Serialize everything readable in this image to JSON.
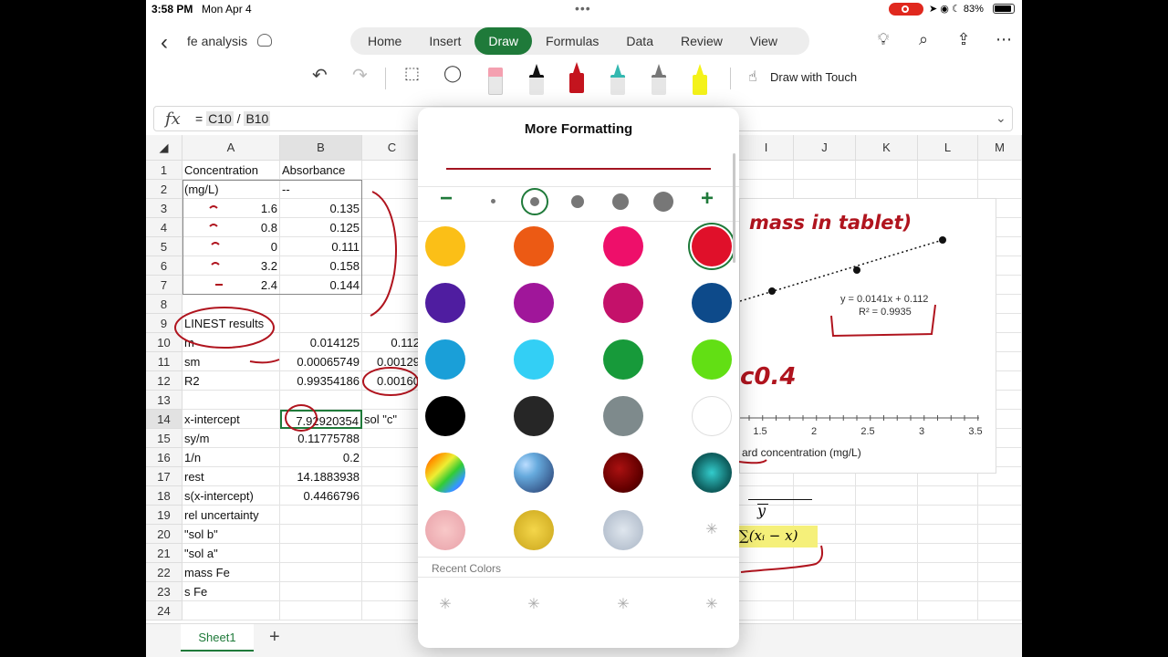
{
  "status": {
    "time": "3:58 PM",
    "date": "Mon Apr 4",
    "battery": "83%"
  },
  "app": {
    "title": "fe analysis",
    "tabs": [
      "Home",
      "Insert",
      "Draw",
      "Formulas",
      "Data",
      "Review",
      "View"
    ],
    "active_tab": "Draw",
    "draw_with_touch": "Draw with Touch"
  },
  "formula": {
    "fx": "fx",
    "prefix": "= ",
    "ref1": "C10",
    "op": " / ",
    "ref2": "B10"
  },
  "columns": [
    "A",
    "B",
    "C",
    "I",
    "J",
    "K",
    "L",
    "M"
  ],
  "rows": [
    "1",
    "2",
    "3",
    "4",
    "5",
    "6",
    "7",
    "8",
    "9",
    "10",
    "11",
    "12",
    "13",
    "14",
    "15",
    "16",
    "17",
    "18",
    "19",
    "20",
    "21",
    "22",
    "23",
    "24"
  ],
  "cells": {
    "A1": "Concentration",
    "B1": "Absorbance",
    "A2": "(mg/L)",
    "B2": "--",
    "A3": "1.6",
    "B3": "0.135",
    "A4": "0.8",
    "B4": "0.125",
    "A5": "0",
    "B5": "0.111",
    "A6": "3.2",
    "B6": "0.158",
    "A7": "2.4",
    "B7": "0.144",
    "A9": "LINEST results",
    "A10": "m",
    "B10": "0.014125",
    "C10": "0.112",
    "A11": "sm",
    "B11": "0.00065749",
    "C11": "0.00129",
    "A12": "R2",
    "B12": "0.99354186",
    "C12": "0.00160",
    "A14": "x-intercept",
    "B14": "7.92920354",
    "C14": "sol \"c\"",
    "A15": "sy/m",
    "B15": "0.11775788",
    "A16": "1/n",
    "B16": "0.2",
    "A17": "rest",
    "B17": "14.1883938",
    "A18": "s(x-intercept)",
    "B18": "0.4466796",
    "A19": "rel uncertainty",
    "A20": "\"sol b\"",
    "A21": "\"sol a\"",
    "A22": "mass Fe",
    "A23": "s Fe"
  },
  "chart": {
    "equation": "y = 0.0141x + 0.112",
    "r2": "R² = 0.9935",
    "xticks": [
      "1.5",
      "2",
      "2.5",
      "3",
      "3.5"
    ],
    "xlabel": "ard concentration (mg/L)",
    "ink_title": "mass in tablet)",
    "ink_note": "c0.4"
  },
  "formula_img": {
    "num": "y",
    "den": "∑(xᵢ − x)"
  },
  "sheet": {
    "name": "Sheet1",
    "add": "+"
  },
  "popover": {
    "title": "More Formatting",
    "minus": "−",
    "plus": "+",
    "recent_label": "Recent Colors",
    "colors": [
      "#fbbf17",
      "#ec5a14",
      "#ee0f6a",
      "#e0102a",
      "#4f1da0",
      "#a0169a",
      "#c4116a",
      "#0d4a8a",
      "#1a9fd8",
      "#33cff5",
      "#179a3a",
      "#62df14",
      "#000000",
      "#262626",
      "#7e8a8c",
      "#ffffff"
    ],
    "selected_color": "#e0102a",
    "pen_color": "#a31420",
    "accent": "#1f7a3a"
  }
}
